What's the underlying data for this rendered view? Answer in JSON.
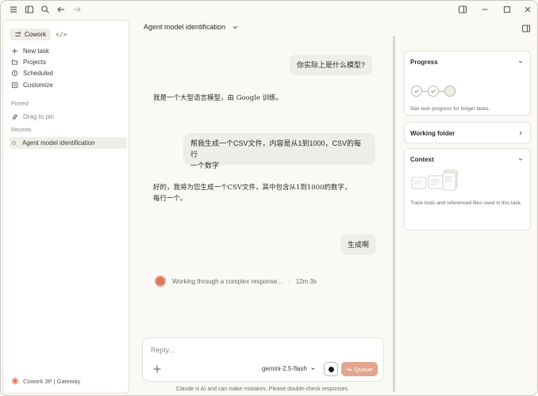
{
  "sidebar": {
    "mode_label": "Cowork",
    "code_label": "</>",
    "items": [
      {
        "label": "New task",
        "icon": "plus-icon"
      },
      {
        "label": "Projects",
        "icon": "folder-icon"
      },
      {
        "label": "Scheduled",
        "icon": "clock-icon"
      },
      {
        "label": "Customize",
        "icon": "customize-icon"
      }
    ],
    "pinned_label": "Pinned",
    "drag_to_pin": "Drag to pin",
    "recents_label": "Recents",
    "recent_items": [
      {
        "label": "Agent model identification"
      }
    ],
    "footer": "Cowork 3P | Gateway"
  },
  "header": {
    "title": "Agent model identification"
  },
  "chat": {
    "user_message_1": "你实际上是什么模型?",
    "assistant_message_1": "我是一个大型语言模型，由 Google 训练。",
    "user_message_2_line1": "帮我生成一个CSV文件，内容是从1到1000，CSV的每行",
    "user_message_2_line2": "一个数字",
    "assistant_message_2_line1": "好的，我将为您生成一个CSV文件，其中包含从1到1000的数字，",
    "assistant_message_2_line2": "每行一个。",
    "user_message_3": "生成啊",
    "status_text": "Working through a complex response...",
    "status_sep": "·",
    "status_time": "12m 3s"
  },
  "composer": {
    "placeholder": "Reply...",
    "model": "gemini-2.5-flash",
    "queue_label": "Queue"
  },
  "disclaimer": "Claude is AI and can make mistakes. Please double-check responses.",
  "right_panel": {
    "progress_title": "Progress",
    "progress_text": "See task progress for longer tasks.",
    "working_folder_title": "Working folder",
    "context_title": "Context",
    "context_text": "Track tools and referenced files used in this task."
  },
  "colors": {
    "accent": "#d9775a",
    "queue_button": "#e2a58e",
    "bubble": "#efede7",
    "background": "#faf9f5"
  }
}
